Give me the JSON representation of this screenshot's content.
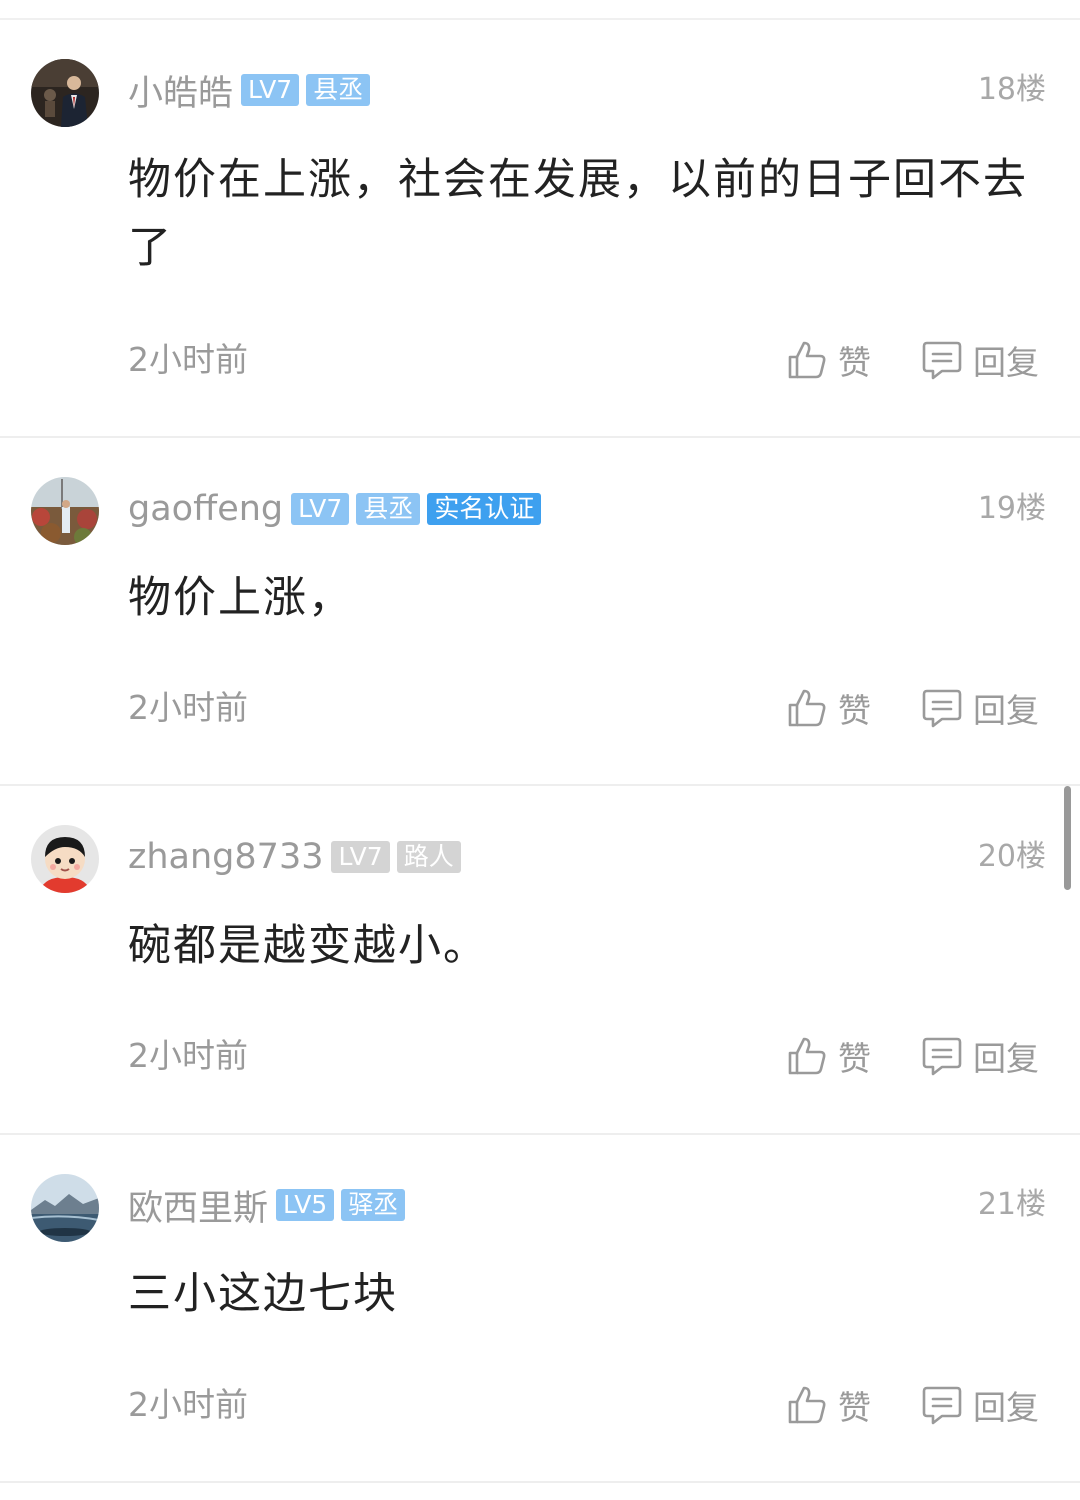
{
  "comments": [
    {
      "username": "小皓皓",
      "badges": [
        {
          "text": "LV7",
          "color": "#8cc4f4"
        },
        {
          "text": "县丞",
          "color": "#8cc4f4"
        }
      ],
      "floor": "18楼",
      "content": "物价在上涨，社会在发展，以前的日子回不去了",
      "time": "2小时前",
      "like_label": "赞",
      "reply_label": "回复"
    },
    {
      "username": "gaoffeng",
      "badges": [
        {
          "text": "LV7",
          "color": "#8cc4f4"
        },
        {
          "text": "县丞",
          "color": "#8cc4f4"
        },
        {
          "text": "实名认证",
          "color": "#3ea0ef"
        }
      ],
      "floor": "19楼",
      "content": "物价上涨，",
      "time": "2小时前",
      "like_label": "赞",
      "reply_label": "回复"
    },
    {
      "username": "zhang8733",
      "badges": [
        {
          "text": "LV7",
          "color": "#d4d4d4"
        },
        {
          "text": "路人",
          "color": "#d4d4d4"
        }
      ],
      "floor": "20楼",
      "content": "碗都是越变越小。",
      "time": "2小时前",
      "like_label": "赞",
      "reply_label": "回复"
    },
    {
      "username": "欧西里斯",
      "badges": [
        {
          "text": "LV5",
          "color": "#8cc4f4"
        },
        {
          "text": "驿丞",
          "color": "#8cc4f4"
        }
      ],
      "floor": "21楼",
      "content": "三小这边七块",
      "time": "2小时前",
      "like_label": "赞",
      "reply_label": "回复"
    }
  ]
}
